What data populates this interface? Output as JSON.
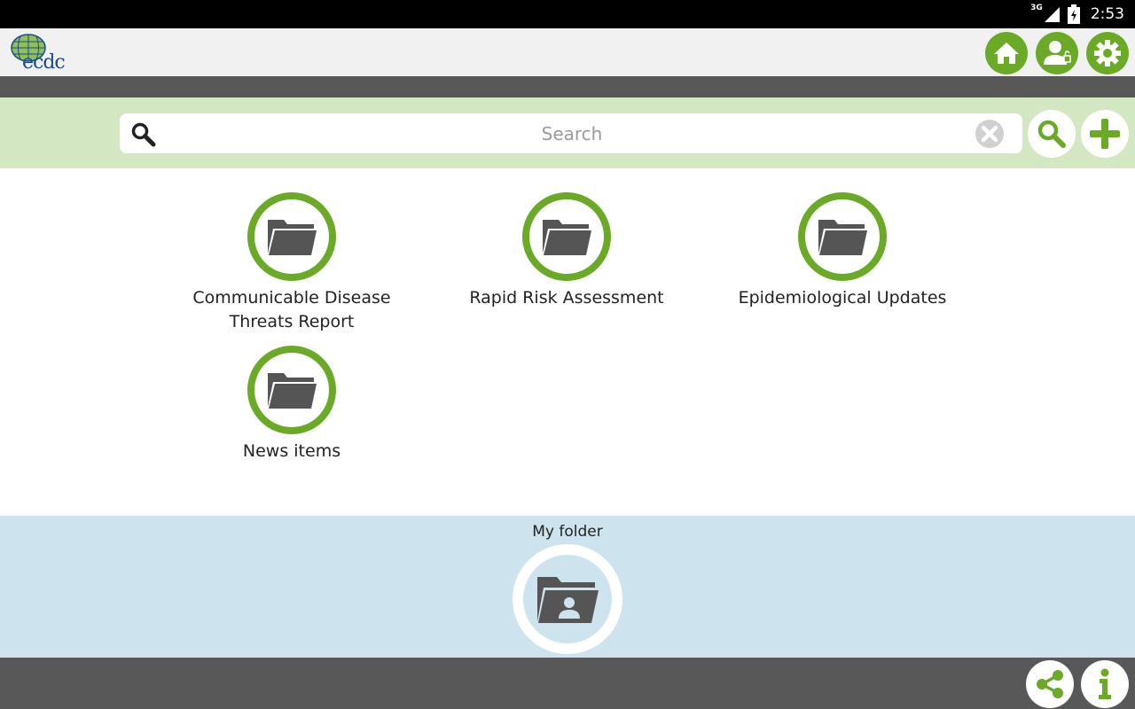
{
  "status_bar": {
    "network": "3G",
    "time": "2:53"
  },
  "header": {
    "logo_text": "ecdc",
    "buttons": [
      {
        "icon": "home-icon"
      },
      {
        "icon": "user-icon"
      },
      {
        "icon": "gear-icon"
      }
    ]
  },
  "search": {
    "placeholder": "Search",
    "value": ""
  },
  "folders": [
    {
      "label": "Communicable Disease Threats Report",
      "icon": "folder-icon"
    },
    {
      "label": "Rapid Risk Assessment",
      "icon": "folder-icon"
    },
    {
      "label": "Epidemiological Updates",
      "icon": "folder-icon"
    },
    {
      "label": "News items",
      "icon": "folder-icon"
    }
  ],
  "my_folder": {
    "label": "My folder",
    "icon": "user-folder-icon"
  },
  "footer": {
    "buttons": [
      {
        "icon": "share-icon"
      },
      {
        "icon": "info-icon"
      }
    ]
  },
  "colors": {
    "accent": "#6aaa27",
    "search_band": "#d3e8c2",
    "my_folder_band": "#cde4ef",
    "dark_bar": "#585858",
    "folder_glyph": "#555555"
  }
}
